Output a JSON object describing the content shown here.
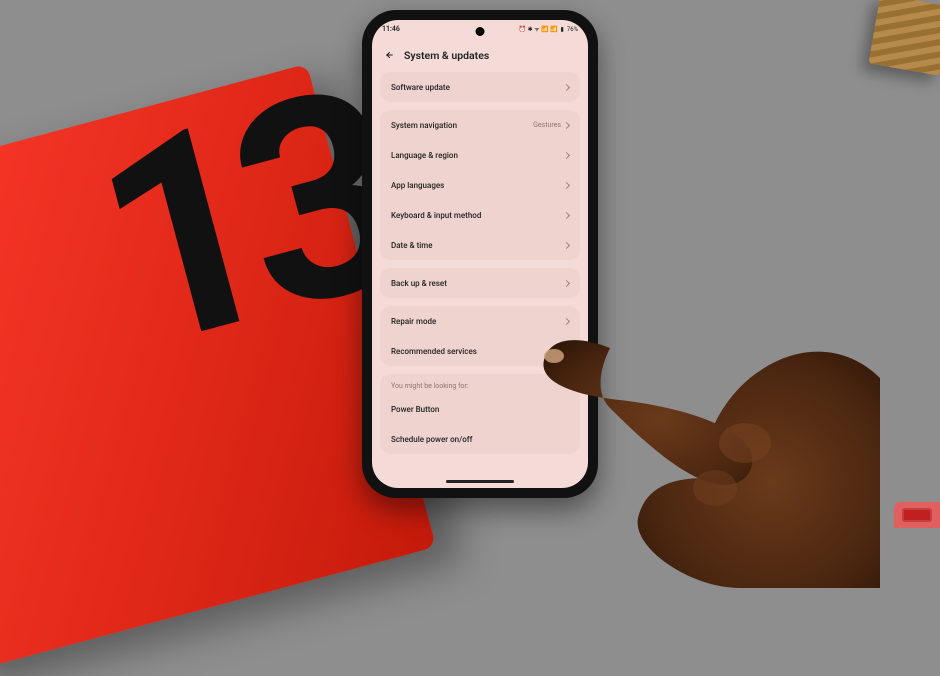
{
  "status_bar": {
    "time": "11:46",
    "indicators": "⏰ ✱ ᯤ 📶 📶",
    "battery_text": "76%",
    "battery_icon": "▮"
  },
  "header": {
    "title": "System & updates"
  },
  "groups": [
    {
      "rows": [
        {
          "label": "Software update",
          "value": ""
        }
      ]
    },
    {
      "rows": [
        {
          "label": "System navigation",
          "value": "Gestures"
        },
        {
          "label": "Language & region",
          "value": ""
        },
        {
          "label": "App languages",
          "value": ""
        },
        {
          "label": "Keyboard & input method",
          "value": ""
        },
        {
          "label": "Date & time",
          "value": ""
        }
      ]
    },
    {
      "rows": [
        {
          "label": "Back up & reset",
          "value": ""
        }
      ]
    },
    {
      "rows": [
        {
          "label": "Repair mode",
          "value": ""
        },
        {
          "label": "Recommended services",
          "value": ""
        }
      ]
    },
    {
      "hint": "You might be looking for:",
      "rows": [
        {
          "label": "Power Button",
          "value": "",
          "no_chevron": true
        },
        {
          "label": "Schedule power on/off",
          "value": "",
          "no_chevron": true
        }
      ]
    }
  ],
  "box_text": "13"
}
